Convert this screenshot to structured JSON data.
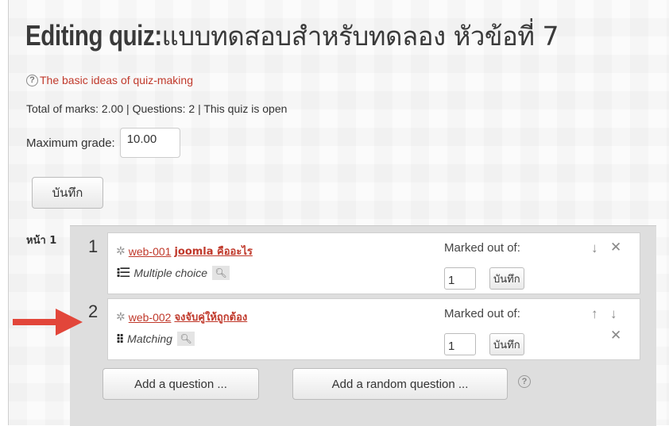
{
  "header": {
    "title_prefix": "Editing quiz: ",
    "title_name": "แบบทดสอบสำหรับทดลอง หัวข้อที่ 7"
  },
  "help": {
    "icon": "help-circle-icon",
    "link": "The basic ideas of quiz-making"
  },
  "status_line": "Total of marks: 2.00 | Questions: 2 | This quiz is open",
  "max_grade": {
    "label": "Maximum grade:",
    "value": "10.00"
  },
  "save_label": "บันทึก",
  "page": {
    "label": "หน้า 1",
    "questions": [
      {
        "number": "1",
        "id": "web-001",
        "name": "joomla คืออะไร",
        "type": "Multiple choice",
        "type_icon": "multichoice-icon",
        "marked_label": "Marked out of:",
        "mark": "1",
        "save_label": "บันทึก"
      },
      {
        "number": "2",
        "id": "web-002",
        "name": "จงจับคู่ให้ถูกต้อง",
        "type": "Matching",
        "type_icon": "matching-icon",
        "marked_label": "Marked out of:",
        "mark": "1",
        "save_label": "บันทึก"
      }
    ],
    "add_question": "Add a question ...",
    "add_random": "Add a random question ..."
  },
  "colors": {
    "link": "#c0392b",
    "arrow": "#e2463a",
    "panel": "#dedede"
  }
}
